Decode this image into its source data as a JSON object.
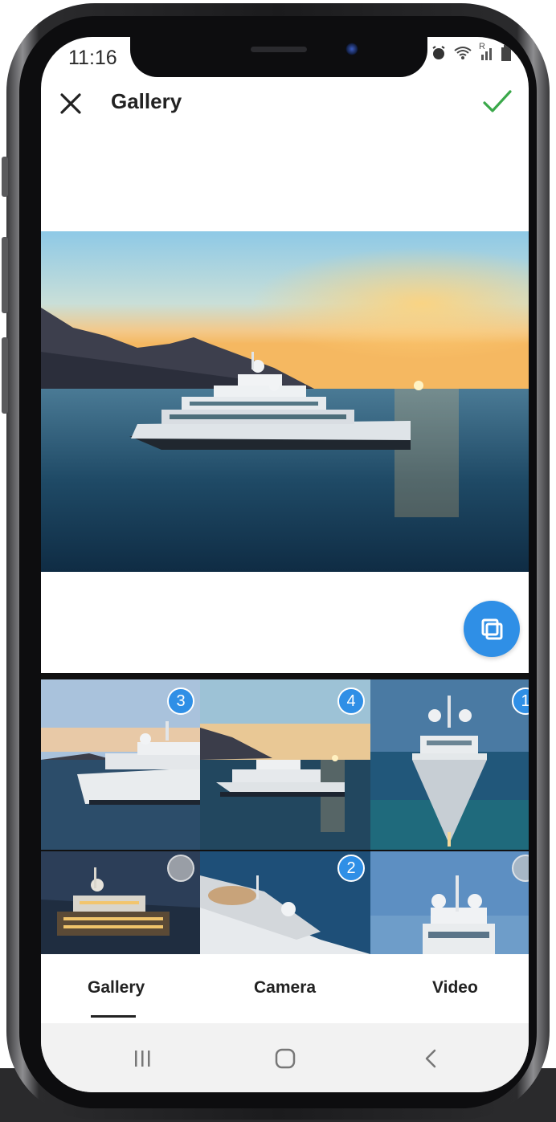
{
  "status_bar": {
    "time": "11:16",
    "signal_badge": "R"
  },
  "header": {
    "title": "Gallery",
    "close_icon": "close-icon",
    "confirm_icon": "check-icon",
    "confirm_color": "#3aa84a"
  },
  "preview": {
    "alt_icon": "multi-select-icon",
    "accent": "#2f8fe6"
  },
  "grid": {
    "thumbnails": [
      {
        "badge": "3"
      },
      {
        "badge": "4"
      },
      {
        "badge": "1"
      },
      {
        "badge": ""
      },
      {
        "badge": "2"
      },
      {
        "badge": ""
      }
    ]
  },
  "tabs": [
    {
      "label": "Gallery",
      "selected": true
    },
    {
      "label": "Camera",
      "selected": false
    },
    {
      "label": "Video",
      "selected": false
    }
  ],
  "navbar": {
    "recents_icon": "recents-icon",
    "home_icon": "home-icon",
    "back_icon": "back-icon"
  }
}
